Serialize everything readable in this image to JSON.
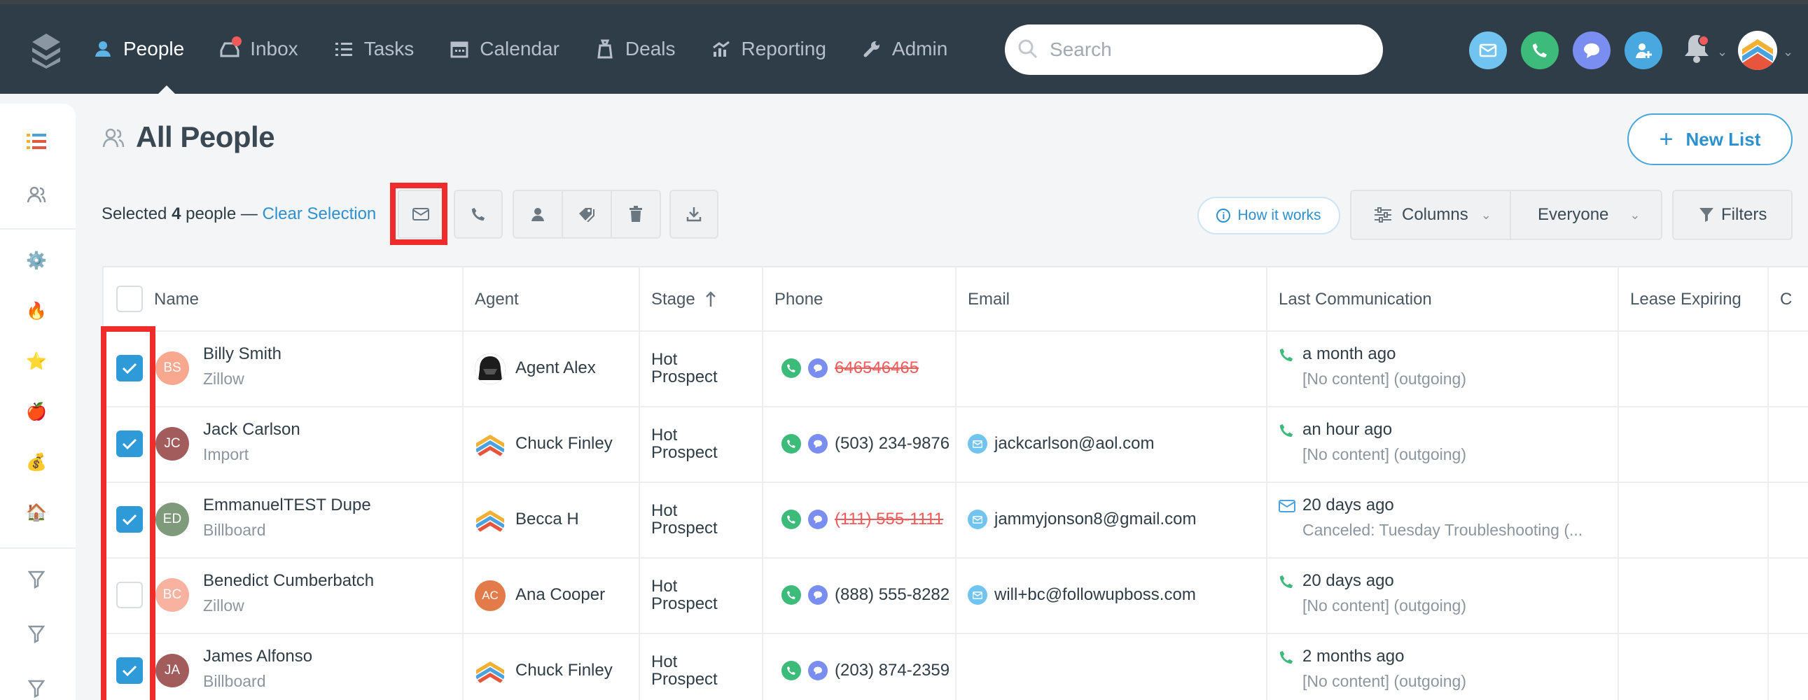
{
  "nav": {
    "items": [
      {
        "label": "People",
        "icon": "people-icon",
        "active": true
      },
      {
        "label": "Inbox",
        "icon": "inbox-icon"
      },
      {
        "label": "Tasks",
        "icon": "tasks-icon"
      },
      {
        "label": "Calendar",
        "icon": "calendar-icon"
      },
      {
        "label": "Deals",
        "icon": "deals-icon"
      },
      {
        "label": "Reporting",
        "icon": "reporting-icon"
      },
      {
        "label": "Admin",
        "icon": "admin-icon"
      }
    ]
  },
  "search": {
    "placeholder": "Search"
  },
  "page": {
    "title": "All People",
    "new_list": "New List"
  },
  "selection": {
    "prefix": "Selected ",
    "count": "4",
    "suffix": " people — ",
    "clear": "Clear Selection"
  },
  "toolbar": {
    "how_it_works": "How it works",
    "columns": "Columns",
    "everyone": "Everyone",
    "filters": "Filters"
  },
  "table": {
    "columns": [
      "Name",
      "Agent",
      "Stage",
      "Phone",
      "Email",
      "Last Communication",
      "Lease Expiring",
      "C"
    ],
    "rows": [
      {
        "checked": true,
        "initials": "BS",
        "avatar_color": "#f7a88f",
        "name": "Billy Smith",
        "source": "Zillow",
        "agent": "Agent Alex",
        "agent_avatar": "helmet",
        "stage1": "Hot",
        "stage2": "Prospect",
        "phone": "646546465",
        "phone_invalid": true,
        "email": "",
        "lc_icon": "phone",
        "lc_time": "a month ago",
        "lc_detail": "[No content] (outgoing)"
      },
      {
        "checked": true,
        "initials": "JC",
        "avatar_color": "#a35c5c",
        "name": "Jack Carlson",
        "source": "Import",
        "agent": "Chuck Finley",
        "agent_avatar": "logo",
        "stage1": "Hot",
        "stage2": "Prospect",
        "phone": "(503) 234-9876",
        "phone_invalid": false,
        "email": "jackcarlson@aol.com",
        "lc_icon": "phone",
        "lc_time": "an hour ago",
        "lc_detail": "[No content] (outgoing)"
      },
      {
        "checked": true,
        "initials": "ED",
        "avatar_color": "#7e9a7a",
        "name": "EmmanuelTEST Dupe",
        "source": "Billboard",
        "agent": "Becca H",
        "agent_avatar": "logo",
        "stage1": "Hot",
        "stage2": "Prospect",
        "phone": "(111) 555-1111",
        "phone_invalid": true,
        "email": "jammyjonson8@gmail.com",
        "lc_icon": "email",
        "lc_time": "20 days ago",
        "lc_detail": "Canceled: Tuesday Troubleshooting (..."
      },
      {
        "checked": false,
        "initials": "BC",
        "avatar_color": "#f7b2a0",
        "name": "Benedict Cumberbatch",
        "source": "Zillow",
        "agent": "Ana Cooper",
        "agent_avatar": "AC",
        "stage1": "Hot",
        "stage2": "Prospect",
        "phone": "(888) 555-8282",
        "phone_invalid": false,
        "email": "will+bc@followupboss.com",
        "lc_icon": "phone",
        "lc_time": "20 days ago",
        "lc_detail": "[No content] (outgoing)"
      },
      {
        "checked": true,
        "initials": "JA",
        "avatar_color": "#a35c5c",
        "name": "James Alfonso",
        "source": "Billboard",
        "agent": "Chuck Finley",
        "agent_avatar": "logo",
        "stage1": "Hot",
        "stage2": "Prospect",
        "phone": "(203) 874-2359",
        "phone_invalid": false,
        "email": "",
        "lc_icon": "phone",
        "lc_time": "2 months ago",
        "lc_detail": "[No content] (outgoing)"
      }
    ]
  },
  "colors": {
    "accent": "#2d90cf",
    "topbar": "#2f3d49",
    "highlight": "#ef2b2b",
    "check": "#2f9ad8"
  }
}
